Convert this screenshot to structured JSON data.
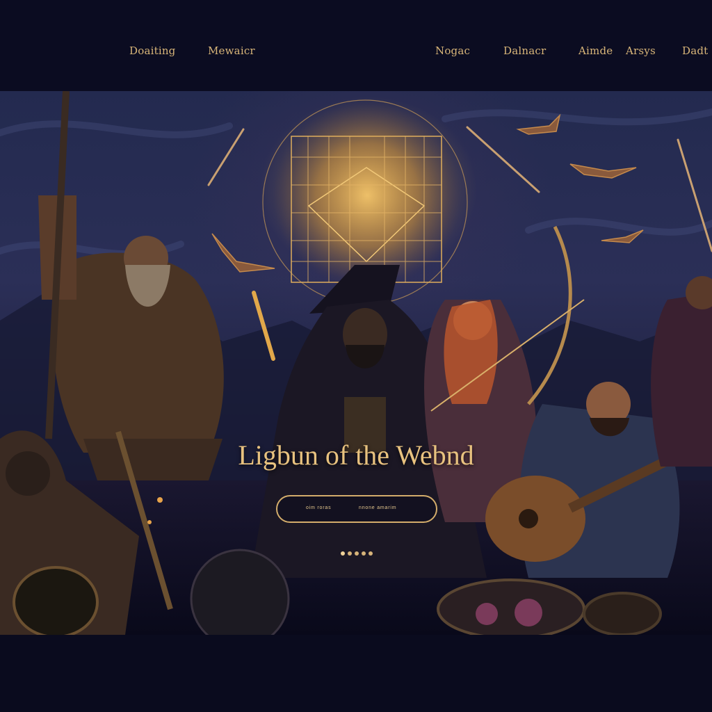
{
  "nav": {
    "left": [
      "Doaiting",
      "Mewaicr"
    ],
    "right": [
      "Nogac",
      "Dalnacr",
      "Aimde",
      "Arsys",
      "Dadt"
    ]
  },
  "hero": {
    "title": "Ligbun of the Webnd",
    "cta_left": "oim roras",
    "cta_right": "nnone amarim",
    "carousel_total": 5,
    "carousel_active": 0
  },
  "colors": {
    "accent_gold": "#d9b679",
    "background": "#0b0c21"
  }
}
